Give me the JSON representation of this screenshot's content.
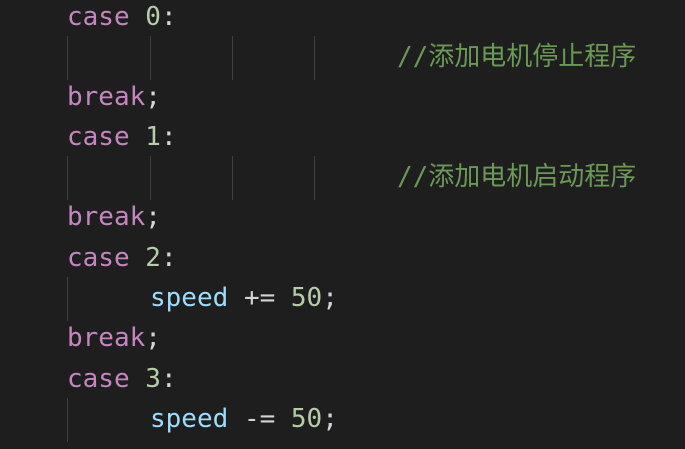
{
  "editor": {
    "theme_colors": {
      "background": "#1e1e1e",
      "keyword": "#c586c0",
      "number": "#b5cea8",
      "variable": "#9cdcfe",
      "comment": "#6a9955",
      "text": "#d4d4d4"
    },
    "lines": {
      "l1": {
        "keyword": "case",
        "number": "0",
        "punc": ":"
      },
      "l2": {
        "comment": "//添加电机停止程序"
      },
      "l3": {
        "keyword": "break",
        "punc": ";"
      },
      "l4": {
        "keyword": "case",
        "number": "1",
        "punc": ":"
      },
      "l5": {
        "comment": "//添加电机启动程序"
      },
      "l6": {
        "keyword": "break",
        "punc": ";"
      },
      "l7": {
        "keyword": "case",
        "number": "2",
        "punc": ":"
      },
      "l8": {
        "variable": "speed",
        "operator": "+=",
        "number": "50",
        "punc": ";"
      },
      "l9": {
        "keyword": "break",
        "punc": ";"
      },
      "l10": {
        "keyword": "case",
        "number": "3",
        "punc": ":"
      },
      "l11": {
        "variable": "speed",
        "operator": "-=",
        "number": "50",
        "punc": ";"
      }
    }
  }
}
